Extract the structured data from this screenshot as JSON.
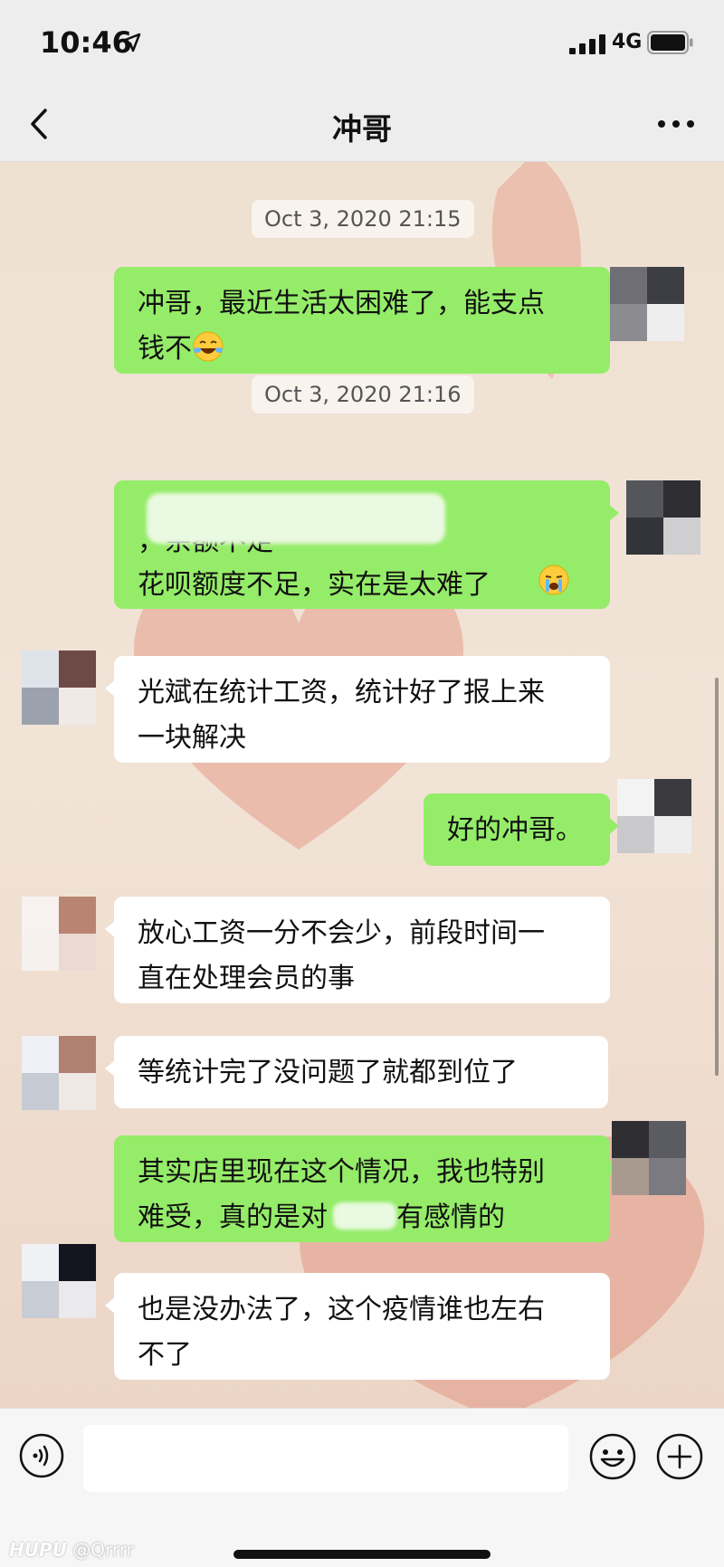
{
  "status_bar": {
    "time": "10:46",
    "network": "4G"
  },
  "header": {
    "title": "冲哥"
  },
  "messages": [
    {
      "type": "timestamp",
      "text": "Oct 3, 2020 21:15"
    },
    {
      "type": "out",
      "text": "冲哥，最近生活太困难了，能支点\n钱不",
      "emoji": "laughing-crying-emoji"
    },
    {
      "type": "timestamp",
      "text": "Oct 3, 2020 21:16"
    },
    {
      "type": "out",
      "redacted": true,
      "text": "，余额不足\n花呗额度不足，实在是太难了",
      "emoji": "crying-emoji"
    },
    {
      "type": "in",
      "text": "光斌在统计工资，统计好了报上来\n一块解决"
    },
    {
      "type": "out",
      "text": "好的冲哥。"
    },
    {
      "type": "in",
      "text": "放心工资一分不会少，前段时间一\n直在处理会员的事"
    },
    {
      "type": "in",
      "text": "等统计完了没问题了就都到位了"
    },
    {
      "type": "out",
      "text": "其实店里现在这个情况，我也特别\n难受，真的是对",
      "tail": "有感情的"
    },
    {
      "type": "in",
      "text": "也是没办法了，这个疫情谁也左右\n不了"
    }
  ],
  "input": {
    "placeholder": ""
  },
  "watermark": {
    "brand": "HUPU",
    "user": "@Qrrrr"
  },
  "colors": {
    "outgoing_bubble": "#95ec69",
    "incoming_bubble": "#ffffff",
    "header_bg": "#ededed"
  }
}
